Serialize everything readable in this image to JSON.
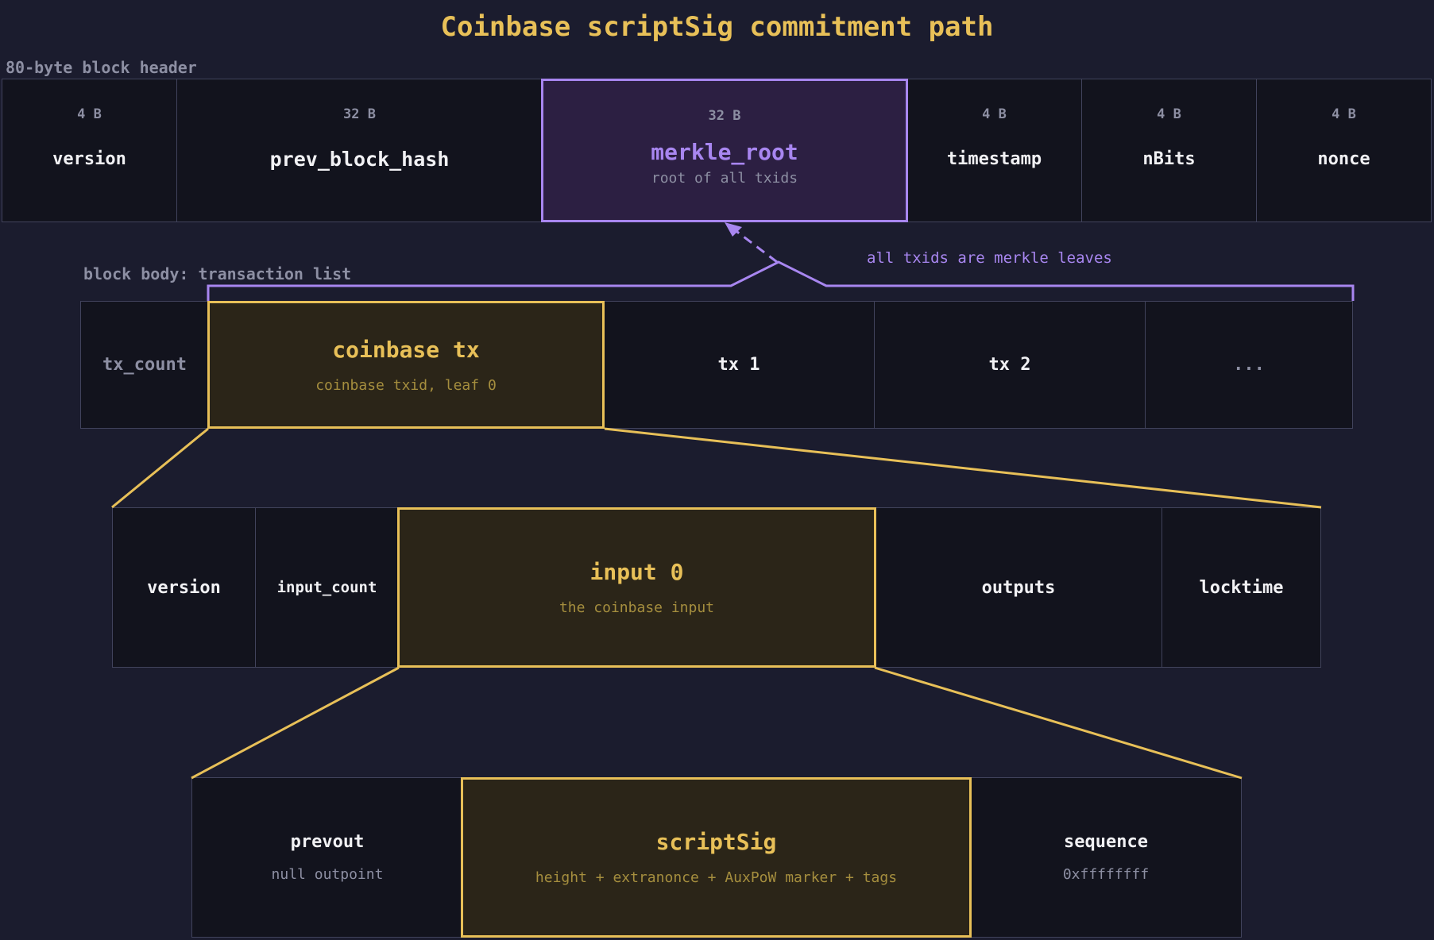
{
  "title": "Coinbase scriptSig commitment path",
  "header": {
    "label": "80-byte block header",
    "fields": [
      {
        "bytes": "4 B",
        "name": "version"
      },
      {
        "bytes": "32 B",
        "name": "prev_block_hash"
      },
      {
        "bytes": "32 B",
        "name": "merkle_root",
        "sub": "root of all txids"
      },
      {
        "bytes": "4 B",
        "name": "timestamp"
      },
      {
        "bytes": "4 B",
        "name": "nBits"
      },
      {
        "bytes": "4 B",
        "name": "nonce"
      }
    ]
  },
  "body": {
    "label": "block body: transaction list",
    "leaves_label": "all txids are merkle leaves",
    "cells": [
      {
        "name": "tx_count"
      },
      {
        "name": "coinbase tx",
        "sub": "coinbase txid, leaf 0"
      },
      {
        "name": "tx 1"
      },
      {
        "name": "tx 2"
      },
      {
        "name": "..."
      }
    ]
  },
  "coinbase_tx": {
    "cells": [
      {
        "name": "version"
      },
      {
        "name": "input_count"
      },
      {
        "name": "input 0",
        "sub": "the coinbase input"
      },
      {
        "name": "outputs"
      },
      {
        "name": "locktime"
      }
    ]
  },
  "input0": {
    "cells": [
      {
        "name": "prevout",
        "sub": "null outpoint"
      },
      {
        "name": "scriptSig",
        "sub": "height + extranonce + AuxPoW marker + tags"
      },
      {
        "name": "sequence",
        "sub": "0xffffffff"
      }
    ]
  },
  "colors": {
    "background": "#1b1c2e",
    "cell": "#12131d",
    "border": "#41435c",
    "gold": "#e8c058",
    "purple": "#a886f0"
  }
}
